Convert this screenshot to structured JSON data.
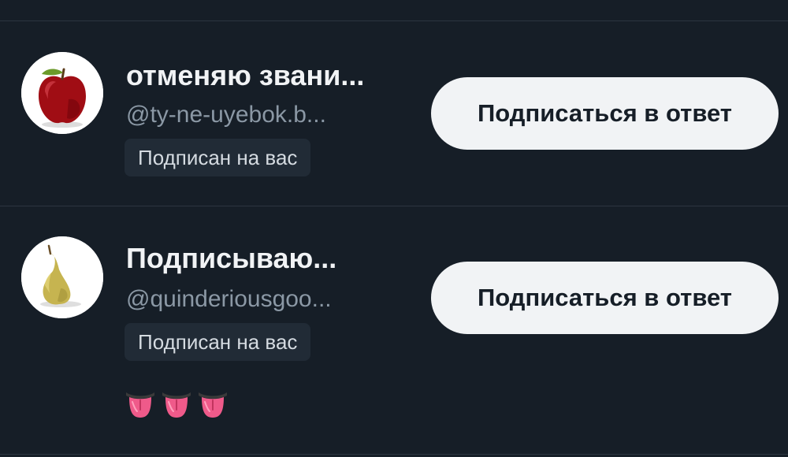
{
  "users": [
    {
      "display_name": "отменяю звани...",
      "handle": "@ty-ne-uyebok.b...",
      "badge": "Подписан на вас",
      "follow_back_label": "Подписаться в ответ",
      "avatar_icon": "apple-icon"
    },
    {
      "display_name": "Подписываю...",
      "handle": "@quinderiousgoo...",
      "badge": "Подписан на вас",
      "follow_back_label": "Подписаться в ответ",
      "avatar_icon": "pear-icon",
      "bio_emoji": [
        "tongue-emoji",
        "tongue-emoji",
        "tongue-emoji"
      ]
    }
  ],
  "colors": {
    "background": "#161e27",
    "divider": "#2c3540",
    "name": "#f1f3f5",
    "handle": "#8b98a5",
    "badge_bg": "#212b36",
    "button_bg": "#f1f3f5"
  }
}
